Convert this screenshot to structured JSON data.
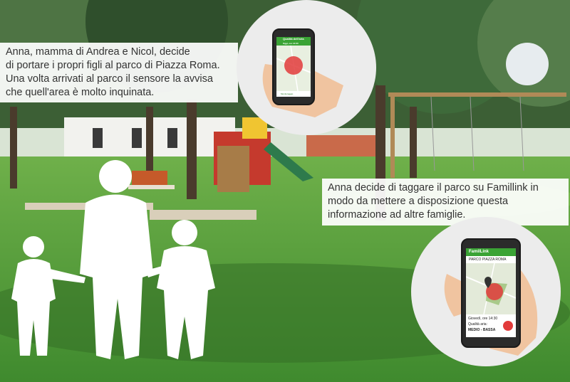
{
  "caption_top": {
    "lines": [
      "Anna, mamma di Andrea e Nicol, decide",
      "di portare i propri figli al parco di Piazza Roma.",
      "Una volta arrivati al parco il sensore la avvisa",
      "che quell'area è molto inquinata."
    ]
  },
  "caption_bottom": {
    "lines": [
      "Anna decide di taggare il parco su Famillink in",
      "modo da mettere a disposizione questa",
      "informazione ad altre famiglie."
    ]
  },
  "phone_top": {
    "header_title": "Qualità dell'aria",
    "header_sub": "Oggi, ore 14:00",
    "footer": "Monitoraggio"
  },
  "phone_bottom": {
    "app_title": "FamilLink",
    "place": "PARCO PIAZZA ROMA",
    "info_line1": "Giovedì, ore 14:30",
    "info_line2": "Qualità aria:",
    "info_line3": "MEDIO - BASSA"
  },
  "colors": {
    "app_green": "#3aa335",
    "alert_red": "#e23b3b",
    "grass": "#4f9a3a"
  }
}
